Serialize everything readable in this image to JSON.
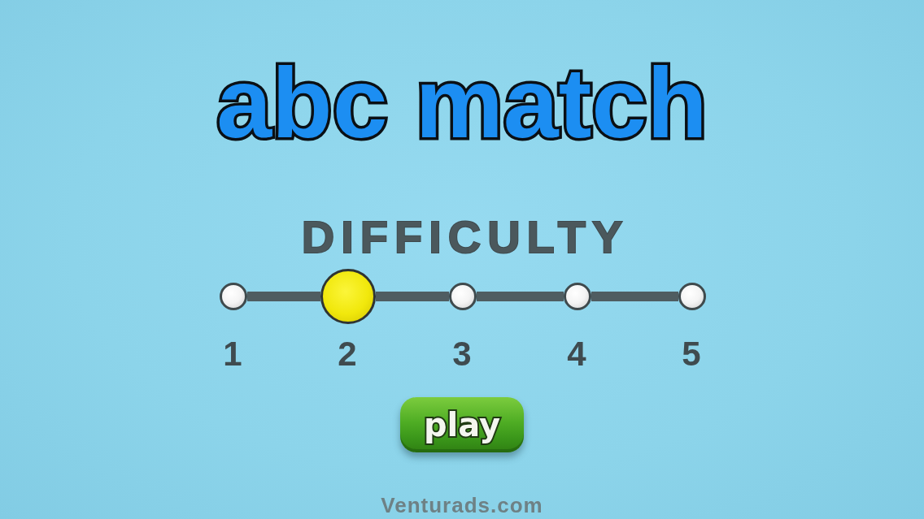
{
  "title": "abc match",
  "difficulty": {
    "label": "DIFFICULTY",
    "levels": [
      {
        "label": "1",
        "selected": false
      },
      {
        "label": "2",
        "selected": true
      },
      {
        "label": "3",
        "selected": false
      },
      {
        "label": "4",
        "selected": false
      },
      {
        "label": "5",
        "selected": false
      }
    ]
  },
  "play_button": {
    "label": "play"
  },
  "footer": "Venturads.com"
}
